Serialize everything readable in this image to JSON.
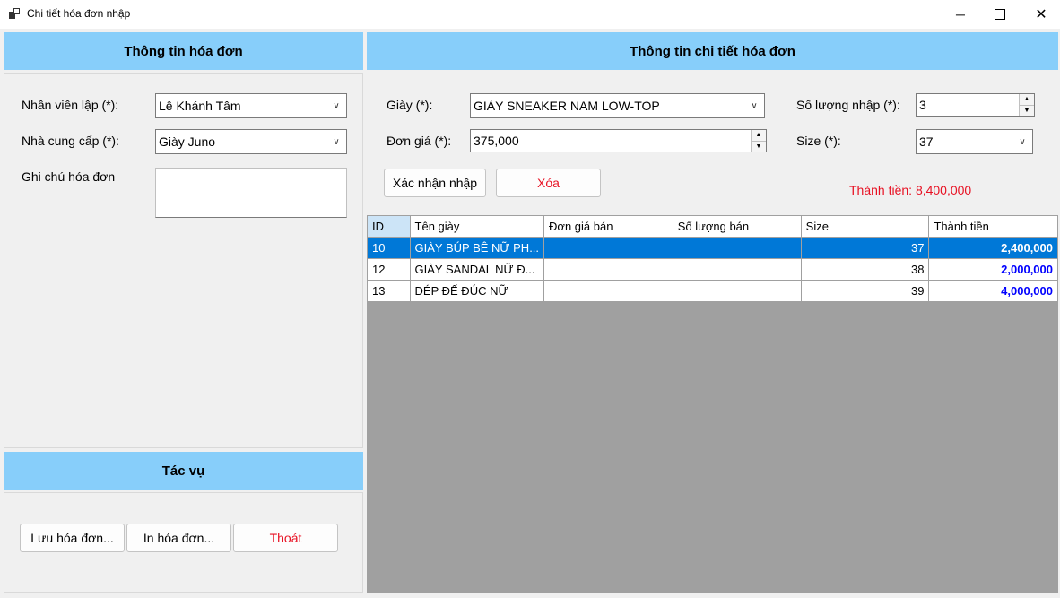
{
  "window": {
    "title": "Chi tiết hóa đơn nhập"
  },
  "left_panel": {
    "header": "Thông tin hóa đơn",
    "employee_label": "Nhân viên lập (*):",
    "employee_value": "Lê Khánh Tâm",
    "supplier_label": "Nhà cung cấp (*):",
    "supplier_value": "Giày Juno",
    "note_label": "Ghi chú hóa đơn",
    "note_value": ""
  },
  "actions_panel": {
    "header": "Tác vụ",
    "save_label": "Lưu hóa đơn...",
    "print_label": "In hóa đơn...",
    "exit_label": "Thoát"
  },
  "detail_panel": {
    "header": "Thông tin chi tiết hóa đơn",
    "shoe_label": "Giày (*):",
    "shoe_value": "GIÀY SNEAKER NAM LOW-TOP",
    "price_label": "Đơn giá (*):",
    "price_value": "375,000",
    "qty_label": "Số lượng nhập (*):",
    "qty_value": "3",
    "size_label": "Size (*):",
    "size_value": "37",
    "confirm_label": "Xác nhận nhập",
    "delete_label": "Xóa",
    "total_text": "Thành tiền: 8,400,000"
  },
  "grid": {
    "columns": [
      "ID",
      "Tên giày",
      "Đơn giá bán",
      "Số lượng bán",
      "Size",
      "Thành tiền"
    ],
    "rows": [
      {
        "id": "10",
        "name": "GIÀY BÚP BÊ NỮ PH...",
        "price": "",
        "qty": "",
        "size": "37",
        "total": "2,400,000"
      },
      {
        "id": "12",
        "name": "GIÀY SANDAL NỮ Đ...",
        "price": "",
        "qty": "",
        "size": "38",
        "total": "2,000,000"
      },
      {
        "id": "13",
        "name": "DÉP ĐẾ ĐÚC NỮ",
        "price": "",
        "qty": "",
        "size": "39",
        "total": "4,000,000"
      }
    ],
    "selected_row_index": 0
  },
  "colors": {
    "header_bg": "#87cefa",
    "selection": "#0078d7",
    "grid_bg": "#a0a0a0",
    "accent_red": "#e81123",
    "total_blue": "#0000ff"
  }
}
